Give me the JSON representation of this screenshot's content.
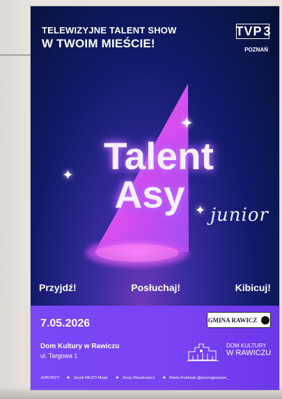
{
  "header": {
    "line1": "TELEWIZYJNE TALENT SHOW",
    "line2": "W TWOIM MIEŚCIE!",
    "tvp_text": "TVP",
    "tvp_number": "3",
    "station": "POZNAŃ"
  },
  "logo": {
    "talent": "Talent",
    "asy": "Asy",
    "junior": "junior"
  },
  "actions": [
    "Przyjdź!",
    "Posłuchaj!",
    "Kibicuj!"
  ],
  "event": {
    "date": "7.05.2026",
    "venue": "Dom Kultury w Rawiczu",
    "address": "ul. Targowa 1"
  },
  "sponsors": {
    "gmina": "GMINA RAWICZ",
    "dk_line1": "DOM KULTURY",
    "dk_line2": "W RAWICZU"
  },
  "jury": {
    "label": "JURORZY:",
    "names": [
      "Jacek MEZO Mejer",
      "Jerzy Moszkowicz",
      "Marta Kubisiak @poznajpoznan_"
    ]
  },
  "colors": {
    "poster_dark_blue": "#061132",
    "purple_band": "#7a46f6",
    "light_cone": "#e45cf1"
  }
}
